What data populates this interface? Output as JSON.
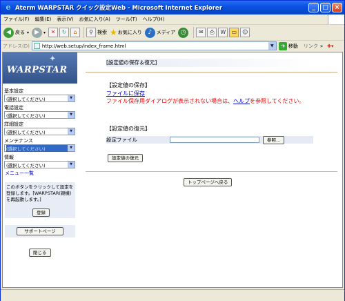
{
  "window": {
    "title": "Aterm WARPSTAR クイック設定Web - Microsoft Internet Explorer",
    "minimize": "_",
    "maximize": "□",
    "close": "×"
  },
  "menubar": [
    "ファイル(F)",
    "編集(E)",
    "表示(V)",
    "お気に入り(A)",
    "ツール(T)",
    "ヘルプ(H)"
  ],
  "toolbar": {
    "back": "戻る",
    "search": "検索",
    "favorites": "お気に入り",
    "media": "メディア"
  },
  "address": {
    "label": "アドレス(D)",
    "url": "http://web.setup/index_frame.html",
    "go": "移動",
    "links": "リンク"
  },
  "sidebar": {
    "logo": "WARPSTAR",
    "sections": [
      {
        "label": "基本設定",
        "value": "(選択してください)"
      },
      {
        "label": "電話設定",
        "value": "(選択してください)"
      },
      {
        "label": "詳細設定",
        "value": "(選択してください)"
      },
      {
        "label": "メンテナンス",
        "value": "(選択してください)"
      },
      {
        "label": "情報",
        "value": "(選択してください)"
      }
    ],
    "menu_list": "メニュー一覧",
    "help_text": "このボタンをクリックして設定を登録します。[WARPSTAR(親機)を再起動します。]",
    "register": "登録",
    "support": "サポートページ",
    "close": "閉じる"
  },
  "main": {
    "title": "[設定値の保存＆復元]",
    "save_heading": "【設定値の保存】",
    "save_link": "ファイルに保存",
    "save_note_1": "ファイル保存用ダイアログが表示されない場合は、",
    "save_note_link": "ヘルプ",
    "save_note_2": "を参照してください。",
    "restore_heading": "【設定値の復元】",
    "file_label": "設定ファイル",
    "browse": "参照...",
    "restore_button": "設定値の復元",
    "top_button": "トップページへ戻る"
  }
}
